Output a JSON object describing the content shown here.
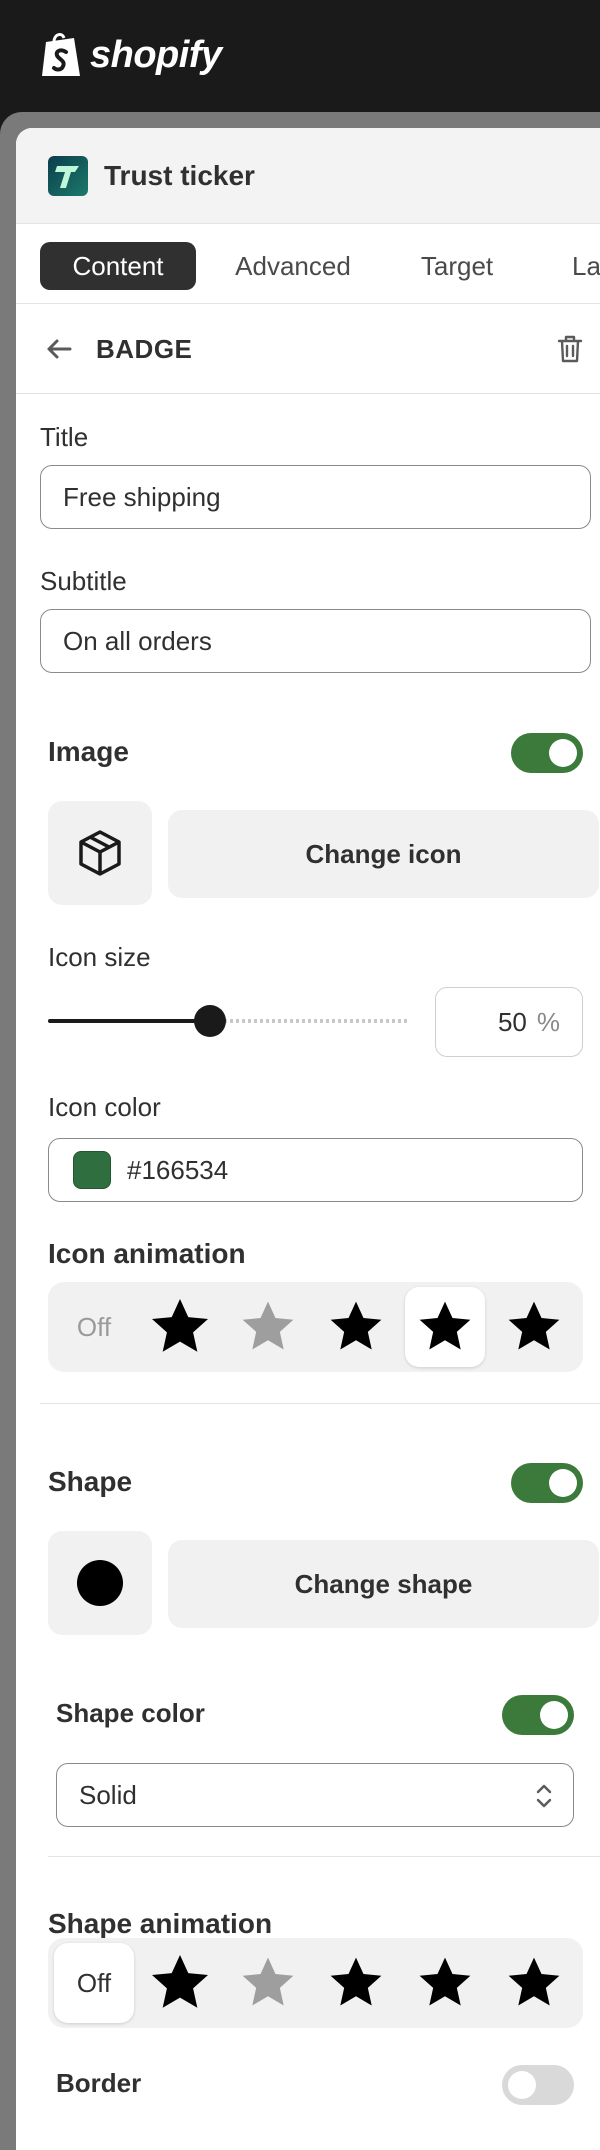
{
  "topbar": {
    "logo_text": "shopify",
    "logo_icon": "shopify-bag-icon"
  },
  "app": {
    "title": "Trust ticker",
    "icon": "trust-ticker-app-icon"
  },
  "tabs": [
    {
      "label": "Content",
      "active": true
    },
    {
      "label": "Advanced",
      "active": false
    },
    {
      "label": "Target",
      "active": false
    },
    {
      "label": "La",
      "active": false
    }
  ],
  "badge": {
    "back_icon": "arrow-left-icon",
    "label": "BADGE",
    "delete_icon": "trash-icon"
  },
  "title_field": {
    "label": "Title",
    "value": "Free shipping"
  },
  "subtitle_field": {
    "label": "Subtitle",
    "value": "On all orders"
  },
  "image_section": {
    "title": "Image",
    "enabled": true,
    "preview_icon": "package-box-icon",
    "change_label": "Change icon"
  },
  "icon_size": {
    "label": "Icon size",
    "value": "50",
    "unit": "%",
    "fraction": 0.5
  },
  "icon_color": {
    "label": "Icon color",
    "value": "#166534",
    "swatch": "#2f6f3f"
  },
  "icon_animation": {
    "label": "Icon animation",
    "off_label": "Off",
    "options": [
      "off",
      "star-bounce-icon",
      "star-fade-icon",
      "star-pulse-icon",
      "star-spin-icon",
      "star-shake-icon"
    ],
    "selected_index": 4
  },
  "shape_section": {
    "title": "Shape",
    "enabled": true,
    "preview_icon": "circle-shape-icon",
    "change_label": "Change shape"
  },
  "shape_color": {
    "label": "Shape color",
    "enabled": true,
    "select_value": "Solid"
  },
  "shape_animation": {
    "label": "Shape animation",
    "off_label": "Off",
    "selected_index": 0
  },
  "border": {
    "label": "Border",
    "enabled": false
  },
  "colors": {
    "accent_green": "#3b7a3b",
    "dark": "#303030",
    "panel_bg": "#ffffff"
  }
}
